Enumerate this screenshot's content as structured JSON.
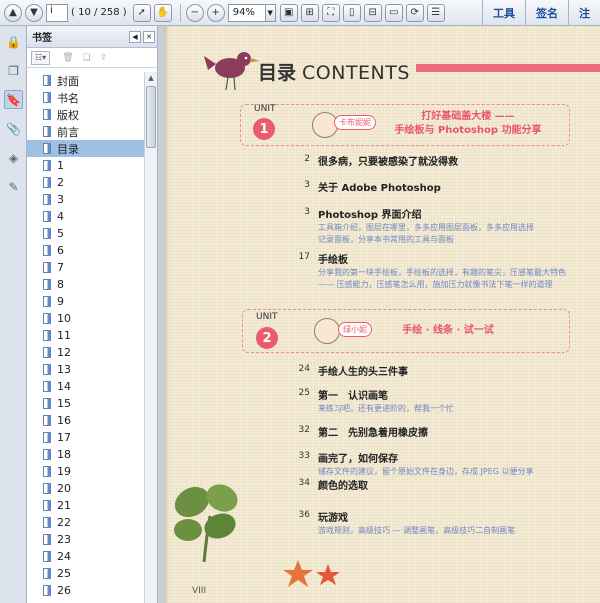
{
  "toolbar": {
    "current_page": "i",
    "page_count": "( 10 / 258 )",
    "zoom": "94%",
    "tools_label": "工具",
    "sign_label": "签名",
    "comment_label": "注"
  },
  "panel": {
    "title": "书签",
    "bookmarks": [
      "封面",
      "书名",
      "版权",
      "前言",
      "目录",
      "1",
      "2",
      "3",
      "4",
      "5",
      "6",
      "7",
      "8",
      "9",
      "10",
      "11",
      "12",
      "13",
      "14",
      "15",
      "16",
      "17",
      "18",
      "19",
      "20",
      "21",
      "22",
      "23",
      "24",
      "25",
      "26"
    ],
    "selected_index": 4
  },
  "page": {
    "title_cn": "目录",
    "title_en": "CONTENTS",
    "unit_word": "UNIT",
    "unit1": {
      "number": "1",
      "bubble": "卡布妮妮",
      "line1": "打好基础盖大楼 ——",
      "line2": "手绘板与 Photoshop 功能分享"
    },
    "unit2": {
      "number": "2",
      "bubble": "绿小妮",
      "line1": "手绘 · 线条 · 试一试"
    },
    "entries": [
      {
        "num": "2",
        "title": "很多病，只要被感染了就没得救",
        "desc": []
      },
      {
        "num": "3",
        "title": "关于 Adobe Photoshop",
        "desc": []
      },
      {
        "num": "3",
        "title": "Photoshop 界面介绍",
        "desc": [
          "工具箱介绍，图层在哪里，多多应用图层面板，多多应用选择",
          "记录面板，分享本书常用的工具与面板"
        ]
      },
      {
        "num": "17",
        "title": "手绘板",
        "desc": [
          "分享我的第一块手绘板，手绘板的选择，有趣的笔尖，压感笔最大特色",
          "—— 压感能力，压感笔怎么用，施加压力就像书法下笔一样的道理"
        ]
      },
      {
        "num": "24",
        "title": "手绘人生的头三件事",
        "desc": []
      },
      {
        "num": "25",
        "title": "第一　认识画笔",
        "desc": [
          "来练习吧，还有更进阶的，帮我一个忙"
        ]
      },
      {
        "num": "32",
        "title": "第二　先别急着用橡皮擦",
        "desc": []
      },
      {
        "num": "33",
        "title": "画完了，如何保存",
        "desc": [
          "储存文件的建议，留个原始文件在身边，存成 JPEG 以便分享"
        ]
      },
      {
        "num": "34",
        "title": "颜色的选取",
        "desc": []
      },
      {
        "num": "36",
        "title": "玩游戏",
        "desc": [
          "游戏规则，高级技巧 — 调整画笔，高级技巧二自制画笔"
        ]
      }
    ],
    "page_number": "VIII"
  },
  "colors": {
    "accent_pink": "#ec5a72",
    "desc_blue": "#6f86c4",
    "paper": "#f4ecd6"
  }
}
